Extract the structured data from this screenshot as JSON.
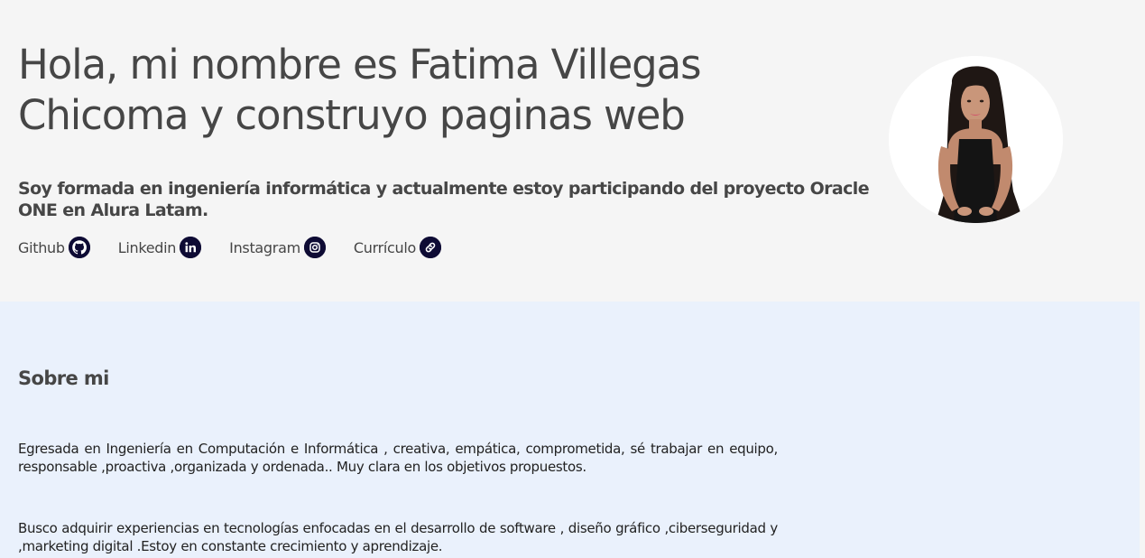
{
  "hero": {
    "title": "Hola, mi nombre es Fatima Villegas Chicoma y construyo paginas web",
    "subtitle": "Soy formada en ingeniería informática y actualmente estoy participando del proyecto Oracle ONE en Alura Latam.",
    "links": [
      {
        "label": "Github",
        "icon": "github-icon"
      },
      {
        "label": "Linkedin",
        "icon": "linkedin-icon"
      },
      {
        "label": "Instagram",
        "icon": "instagram-icon"
      },
      {
        "label": "Currículo",
        "icon": "link-icon"
      }
    ],
    "avatar": {
      "alt": "profile photo"
    }
  },
  "about": {
    "title": "Sobre mi",
    "paragraphs": [
      "Egresada en Ingeniería en Computación e Informática , creativa, empática, comprometida, sé trabajar en equipo, responsable ,proactiva ,organizada y ordenada.. Muy clara en los objetivos propuestos.",
      "Busco adquirir experiencias en tecnologías enfocadas en el desarrollo de software , diseño gráfico ,ciberseguridad y ,marketing digital .Estoy en constante crecimiento y aprendizaje."
    ]
  },
  "colors": {
    "hero_bg": "#f5f5f5",
    "about_bg": "#eaf1fc",
    "text": "#464646",
    "icon_bg": "#0e0b34"
  }
}
